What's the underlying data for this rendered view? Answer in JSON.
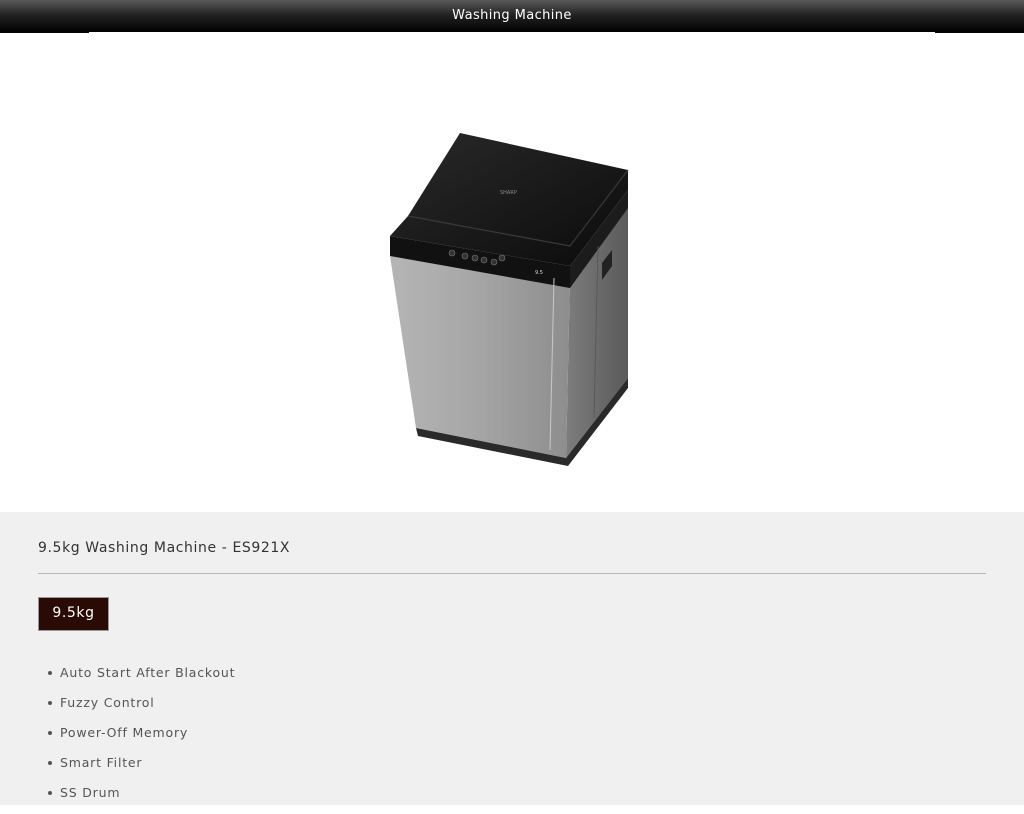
{
  "header": {
    "title": "Washing Machine"
  },
  "product": {
    "image_label": "SHARP",
    "display_readout": "9.5",
    "title": "9.5kg Washing Machine - ES921X",
    "capacity_option": "9.5kg",
    "features": [
      "Auto Start After Blackout",
      "Fuzzy Control",
      "Power-Off Memory",
      "Smart Filter",
      "SS Drum"
    ]
  },
  "colors": {
    "header_background": "#000000",
    "details_background": "#f0f0f0",
    "capacity_button_background": "#2a0a04",
    "machine_body": "#9a9a9a",
    "machine_lid": "#151515"
  }
}
